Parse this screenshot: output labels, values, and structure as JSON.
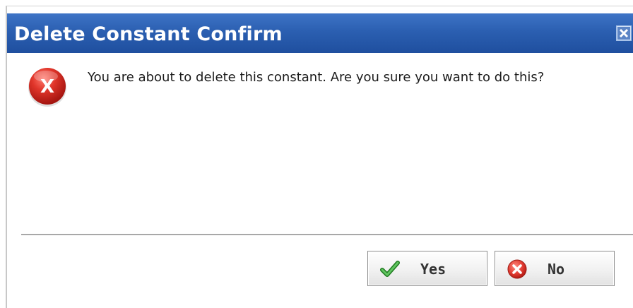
{
  "dialog": {
    "title": "Delete Constant Confirm",
    "message": "You are about to delete this constant. Are you sure you want to do this?",
    "icon": "error-icon",
    "close_icon": "close-icon"
  },
  "buttons": {
    "yes_label": "Yes",
    "yes_icon": "checkmark-icon",
    "no_label": "No",
    "no_icon": "cancel-icon"
  },
  "colors": {
    "titlebar": "#2b5fb1",
    "title_text": "#ffffff",
    "error_red": "#d42a24",
    "check_green": "#2f9a2f"
  }
}
